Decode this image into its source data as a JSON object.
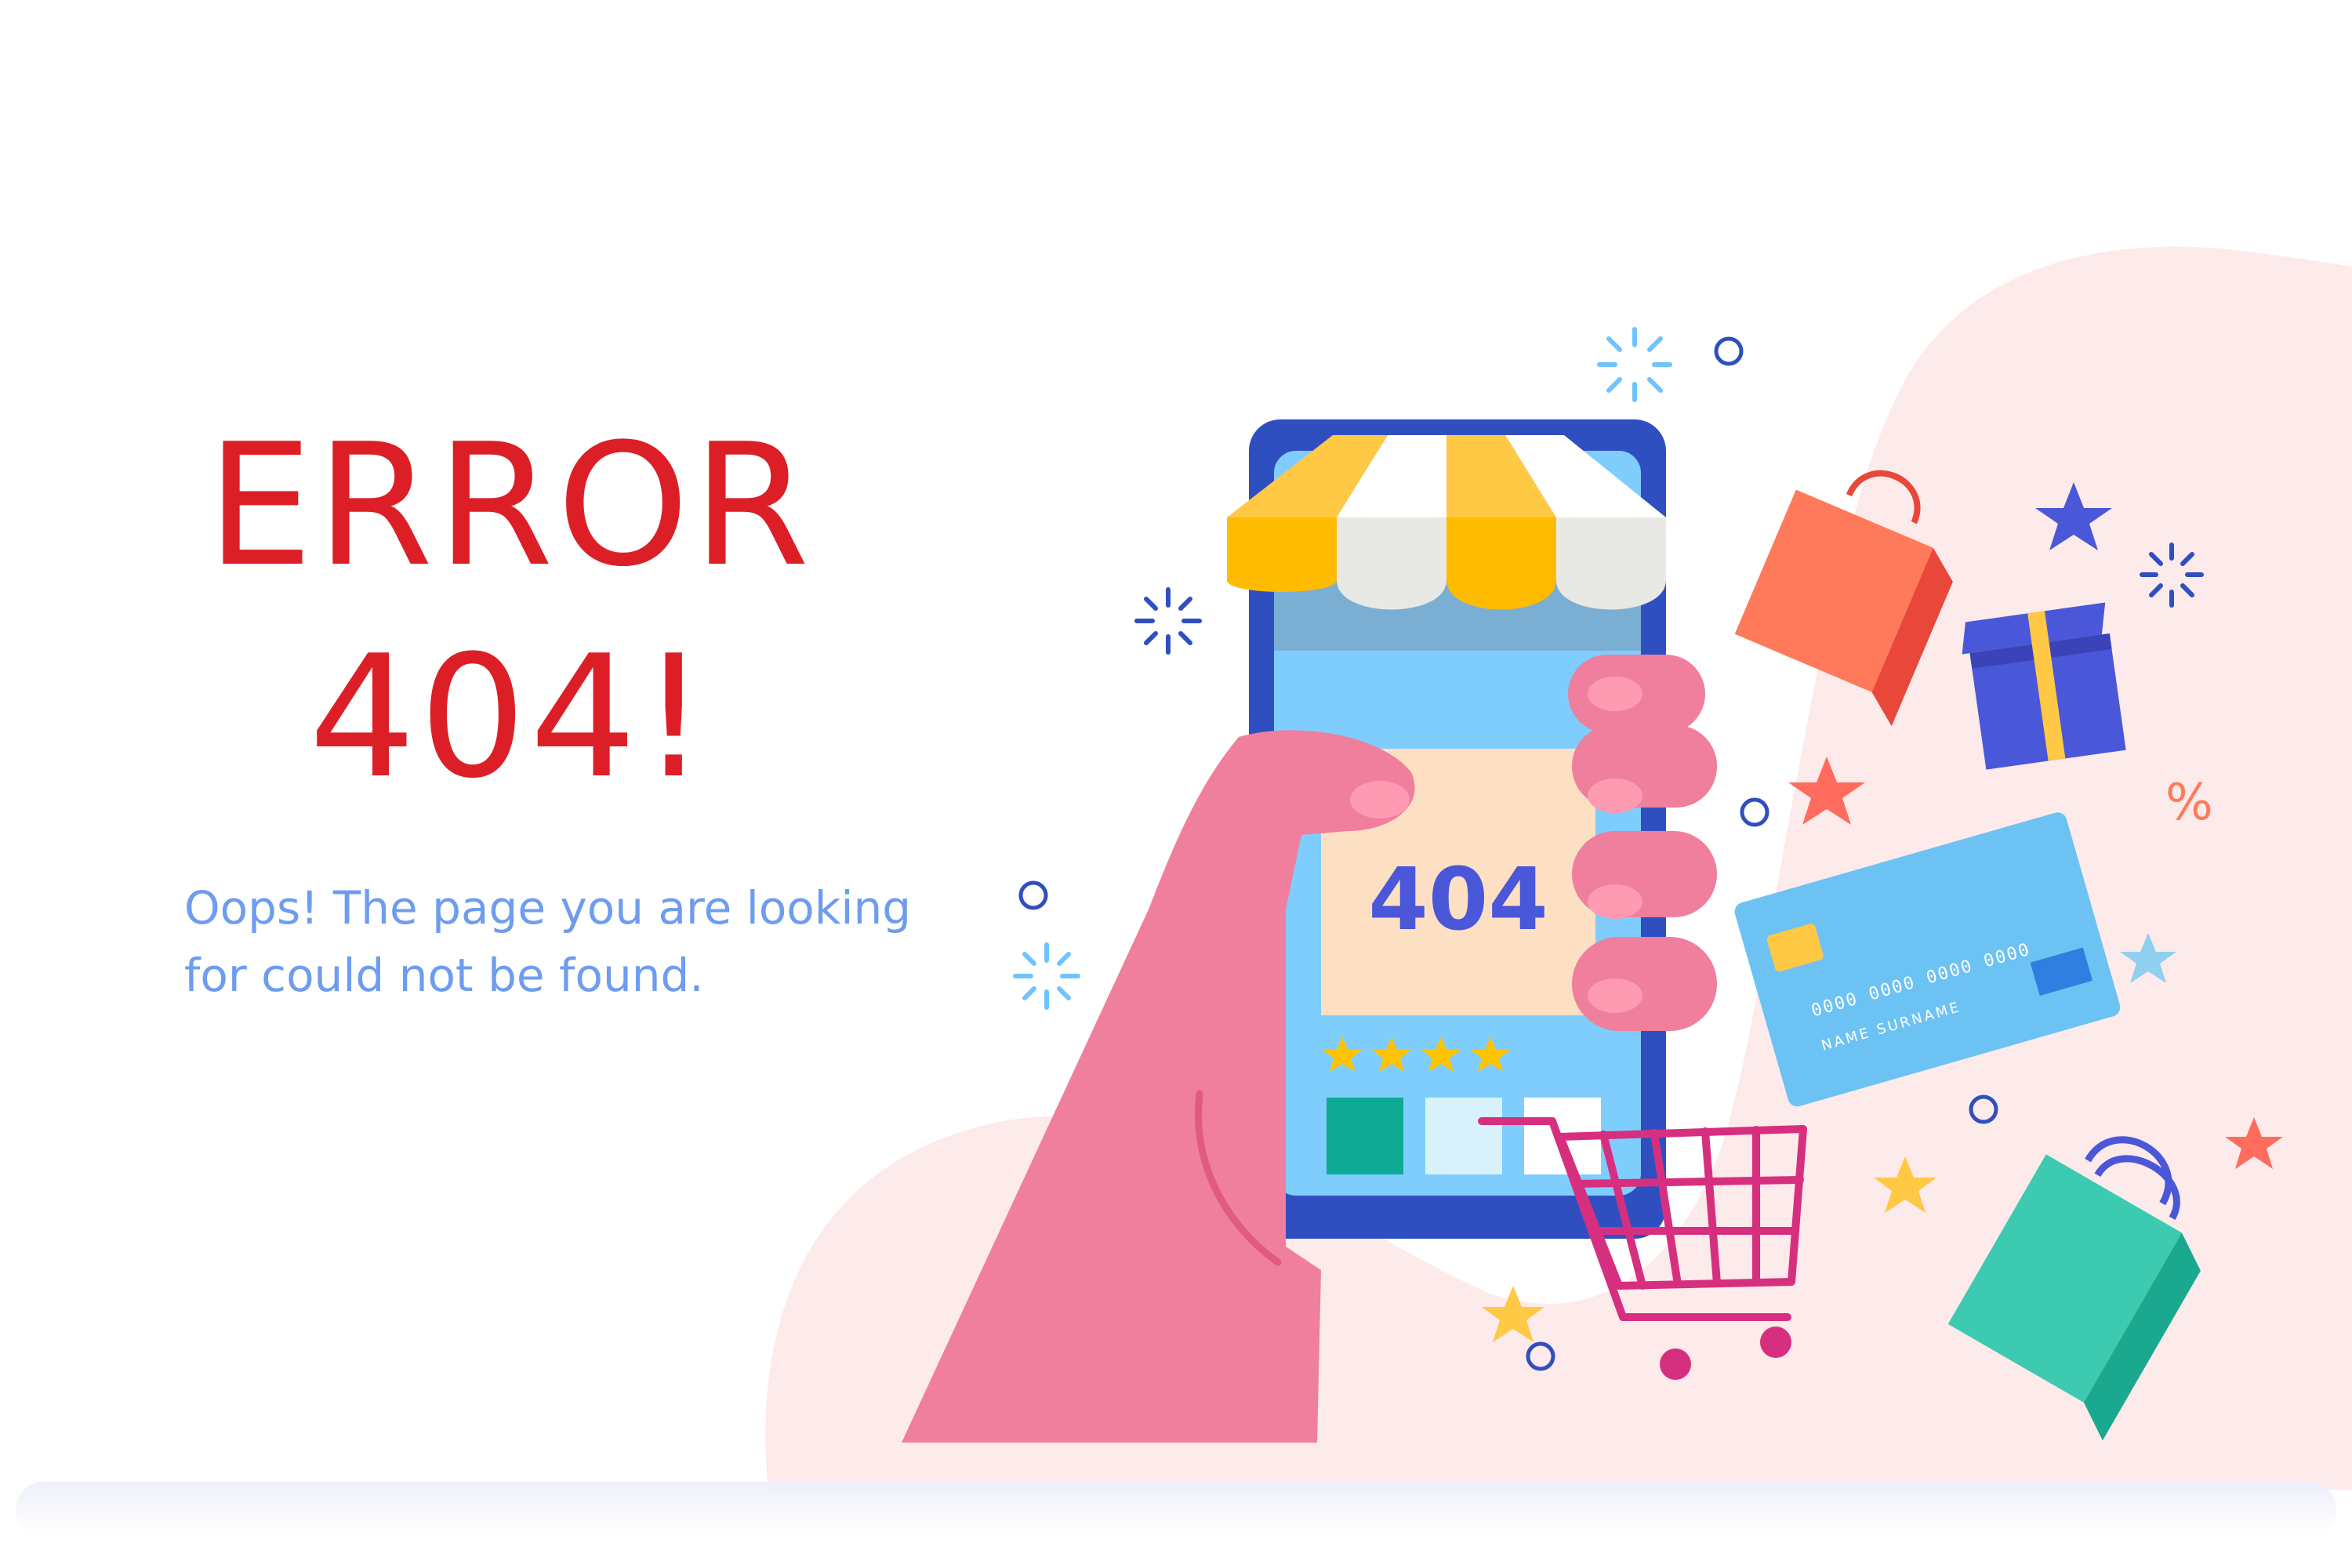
{
  "error": {
    "line1": "ERROR",
    "line2": "404!",
    "message": "Oops! The page you are looking for could not be found."
  },
  "phone": {
    "screen_text": "404",
    "rating_stars": 4
  },
  "credit_card": {
    "number": "0000 0000 0000 0000",
    "name": "NAME SURNAME"
  },
  "decor": {
    "percent_sign": "%"
  },
  "colors": {
    "error_red": "#dc1f26",
    "message_blue": "#6e9cf0",
    "blob_pink": "#fdeaea",
    "hand_pink": "#ef7f9c",
    "phone_blue": "#2f4fc0",
    "screen_blue": "#7fcdfd"
  }
}
